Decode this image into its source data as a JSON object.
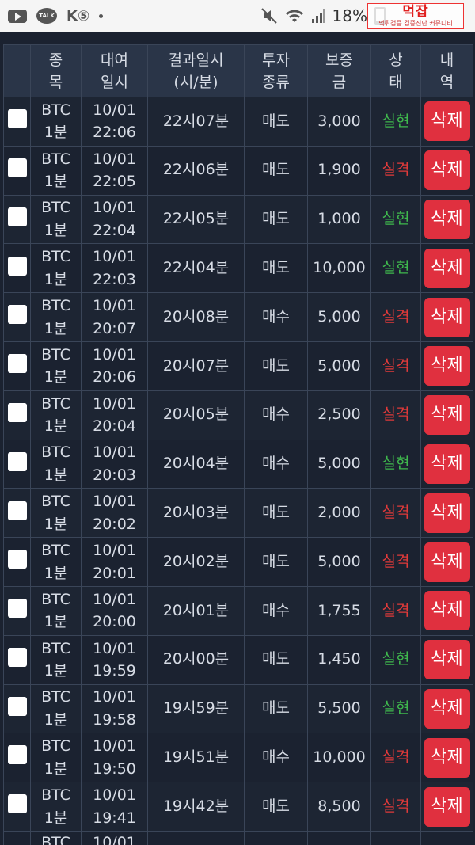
{
  "status_bar": {
    "left_icons": [
      "youtube-icon",
      "kakaotalk-icon",
      "ks-icon",
      "notification-dot-icon"
    ],
    "battery_percent": "18%",
    "watermark_title": "먹잡",
    "watermark_sub": "먹튀검증 검증진단 커뮤니티"
  },
  "table": {
    "headers": [
      {
        "key": "select",
        "label": ""
      },
      {
        "key": "symbol",
        "label": "종\n목"
      },
      {
        "key": "rental_time",
        "label": "대여\n일시"
      },
      {
        "key": "result_time",
        "label": "결과일시\n(시/분)"
      },
      {
        "key": "invest_type",
        "label": "투자\n종류"
      },
      {
        "key": "deposit",
        "label": "보증\n금"
      },
      {
        "key": "status",
        "label": "상\n태"
      },
      {
        "key": "detail",
        "label": "내\n역"
      }
    ],
    "delete_label": "삭제",
    "rows": [
      {
        "symbol": "BTC\n1분",
        "rental": "10/01\n22:06",
        "result": "22시07분",
        "type": "매도",
        "deposit": "3,000",
        "status": "실현",
        "win": true
      },
      {
        "symbol": "BTC\n1분",
        "rental": "10/01\n22:05",
        "result": "22시06분",
        "type": "매도",
        "deposit": "1,900",
        "status": "실격",
        "win": false
      },
      {
        "symbol": "BTC\n1분",
        "rental": "10/01\n22:04",
        "result": "22시05분",
        "type": "매도",
        "deposit": "1,000",
        "status": "실현",
        "win": true
      },
      {
        "symbol": "BTC\n1분",
        "rental": "10/01\n22:03",
        "result": "22시04분",
        "type": "매도",
        "deposit": "10,000",
        "status": "실현",
        "win": true
      },
      {
        "symbol": "BTC\n1분",
        "rental": "10/01\n20:07",
        "result": "20시08분",
        "type": "매수",
        "deposit": "5,000",
        "status": "실격",
        "win": false
      },
      {
        "symbol": "BTC\n1분",
        "rental": "10/01\n20:06",
        "result": "20시07분",
        "type": "매도",
        "deposit": "5,000",
        "status": "실격",
        "win": false
      },
      {
        "symbol": "BTC\n1분",
        "rental": "10/01\n20:04",
        "result": "20시05분",
        "type": "매수",
        "deposit": "2,500",
        "status": "실격",
        "win": false
      },
      {
        "symbol": "BTC\n1분",
        "rental": "10/01\n20:03",
        "result": "20시04분",
        "type": "매수",
        "deposit": "5,000",
        "status": "실현",
        "win": true
      },
      {
        "symbol": "BTC\n1분",
        "rental": "10/01\n20:02",
        "result": "20시03분",
        "type": "매도",
        "deposit": "2,000",
        "status": "실격",
        "win": false
      },
      {
        "symbol": "BTC\n1분",
        "rental": "10/01\n20:01",
        "result": "20시02분",
        "type": "매도",
        "deposit": "5,000",
        "status": "실격",
        "win": false
      },
      {
        "symbol": "BTC\n1분",
        "rental": "10/01\n20:00",
        "result": "20시01분",
        "type": "매수",
        "deposit": "1,755",
        "status": "실격",
        "win": false
      },
      {
        "symbol": "BTC\n1분",
        "rental": "10/01\n19:59",
        "result": "20시00분",
        "type": "매도",
        "deposit": "1,450",
        "status": "실현",
        "win": true
      },
      {
        "symbol": "BTC\n1분",
        "rental": "10/01\n19:58",
        "result": "19시59분",
        "type": "매도",
        "deposit": "5,500",
        "status": "실현",
        "win": true
      },
      {
        "symbol": "BTC\n1분",
        "rental": "10/01\n19:50",
        "result": "19시51분",
        "type": "매수",
        "deposit": "10,000",
        "status": "실격",
        "win": false
      },
      {
        "symbol": "BTC\n1분",
        "rental": "10/01\n19:41",
        "result": "19시42분",
        "type": "매도",
        "deposit": "8,500",
        "status": "실격",
        "win": false
      },
      {
        "symbol": "BTC",
        "rental": "10/01",
        "result": "",
        "type": "",
        "deposit": "",
        "status": "",
        "win": true,
        "partial": true
      }
    ]
  },
  "colors": {
    "background": "#1b2230",
    "header_bg": "#2a3548",
    "win": "#3fb84d",
    "lose": "#e03a3a",
    "delete_button": "#e0303f"
  }
}
